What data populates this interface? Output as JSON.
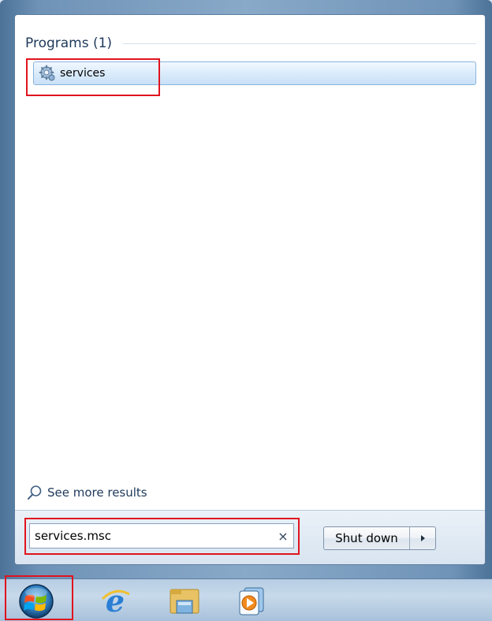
{
  "start_menu": {
    "programs_header": "Programs (1)",
    "result": {
      "label": "services",
      "icon": "services-gear-icon"
    },
    "see_more_label": "See more results",
    "search": {
      "value": "services.msc",
      "clear_icon": "clear-x-icon",
      "clear_glyph": "×"
    },
    "shutdown": {
      "label": "Shut down",
      "arrow_icon": "right-arrow-icon"
    }
  },
  "taskbar": {
    "start_button": "windows-orb-icon",
    "pinned": [
      "internet-explorer-icon",
      "windows-explorer-icon",
      "windows-media-player-icon"
    ]
  },
  "colors": {
    "highlight": "#e0141e",
    "header_text": "#1e395b",
    "selection": "#c9e0f6"
  }
}
